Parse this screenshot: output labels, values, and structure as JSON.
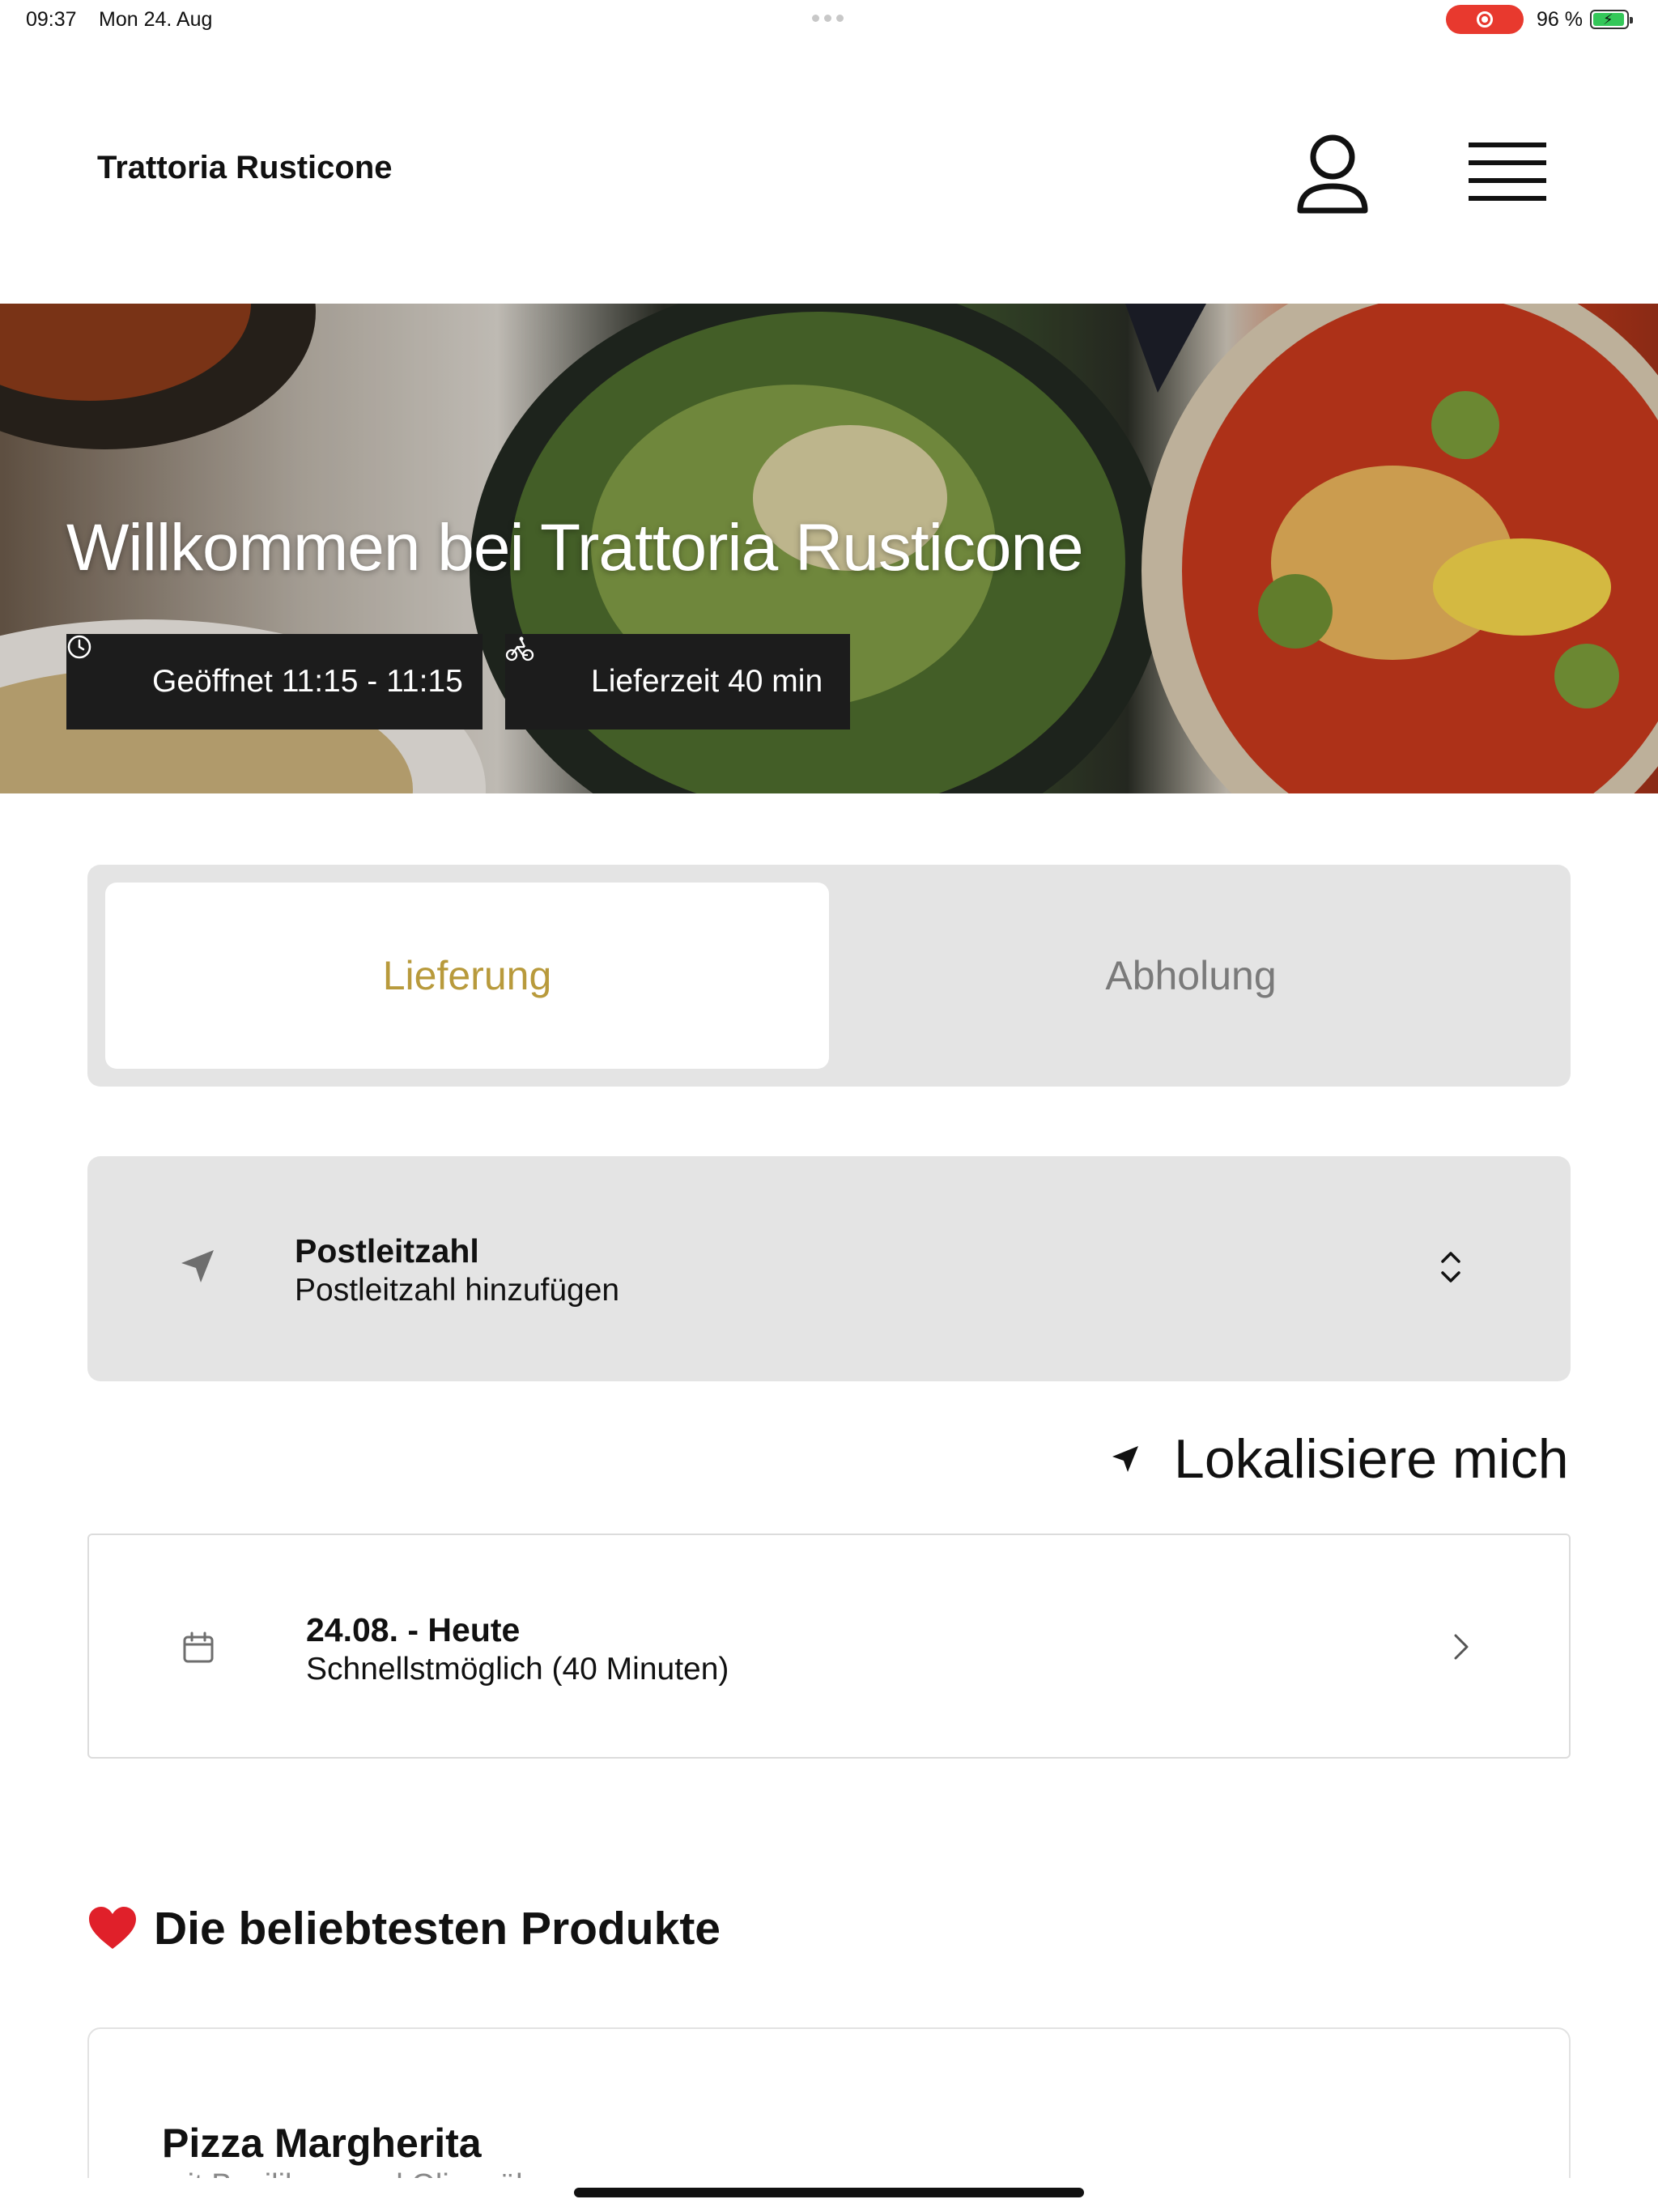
{
  "status_bar": {
    "time": "09:37",
    "date": "Mon 24. Aug",
    "battery_percent": "96 %",
    "battery_level": 0.96,
    "recording": true
  },
  "header": {
    "brand": "Trattoria Rusticone",
    "icons": [
      "user-icon",
      "hamburger-menu-icon"
    ]
  },
  "hero": {
    "title": "Willkommen bei Trattoria Rusticone",
    "opening_hours": "Geöffnet 11:15 - 11:15",
    "delivery_time": "Lieferzeit 40 min",
    "icons": [
      "clock-icon",
      "bicycle-icon"
    ]
  },
  "order_mode": {
    "options": [
      "Lieferung",
      "Abholung"
    ],
    "selected": "Lieferung",
    "accent_color": "#b89a3c"
  },
  "postal_code": {
    "title": "Postleitzahl",
    "placeholder": "Postleitzahl hinzufügen",
    "icons": [
      "location-arrow-icon",
      "up-down-chevron-icon"
    ]
  },
  "locate": {
    "label": "Lokalisiere mich",
    "icon": "location-arrow-icon"
  },
  "schedule": {
    "title": "24.08. - Heute",
    "subtitle": "Schnellstmöglich (40 Minuten)",
    "icons": [
      "calendar-icon",
      "chevron-right-icon"
    ]
  },
  "popular": {
    "title": "Die beliebtesten Produkte",
    "icon": "heart-icon",
    "products": [
      {
        "name": "Pizza Margherita",
        "description": "mit Basilikum und Olivenöl"
      }
    ]
  }
}
